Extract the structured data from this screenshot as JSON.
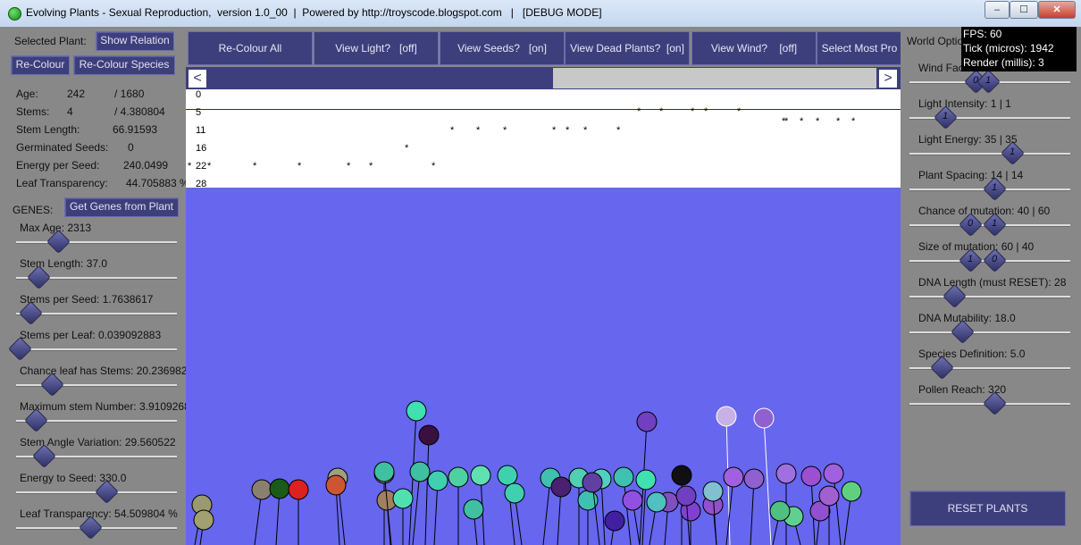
{
  "window": {
    "title": "Evolving Plants - Sexual Reproduction,  version 1.0_00  |  Powered by http://troyscode.blogspot.com   |   [DEBUG MODE]",
    "controls": {
      "minimize": "‒",
      "maximize": "☐",
      "close": "✕"
    }
  },
  "left": {
    "selected_plant_label": "Selected Plant:",
    "show_relation": "Show Relation",
    "recolour": "Re-Colour",
    "recolour_species": "Re-Colour Species",
    "stats": [
      {
        "label": "Age:",
        "value": "242",
        "extra": "/ 1680"
      },
      {
        "label": "Stems:",
        "value": "4",
        "extra": "/ 4.380804"
      },
      {
        "label": "Stem Length:",
        "value": "66.91593",
        "extra": ""
      },
      {
        "label": "Germinated Seeds:",
        "value": "0",
        "extra": ""
      },
      {
        "label": "Energy per Seed:",
        "value": "240.0499",
        "extra": ""
      },
      {
        "label": "Leaf Transparency:",
        "value": "44.705883 %",
        "extra": ""
      }
    ],
    "genes_label": "GENES:",
    "get_genes": "Get Genes from Plant",
    "genes": [
      {
        "label": "Max Age: 2313",
        "level": 0.26
      },
      {
        "label": "Stem Length: 37.0",
        "level": 0.14
      },
      {
        "label": "Stems per Seed: 1.7638617",
        "level": 0.09
      },
      {
        "label": "Stems per Leaf: 0.039092883",
        "level": 0.02
      },
      {
        "label": "Chance leaf has Stems: 20.236982",
        "level": 0.22
      },
      {
        "label": "Maximum stem Number: 3.9109268",
        "level": 0.12
      },
      {
        "label": "Stem Angle Variation: 29.560522",
        "level": 0.17
      },
      {
        "label": "Energy to Seed: 330.0",
        "level": 0.56
      },
      {
        "label": "Leaf Transparency: 54.509804 %",
        "level": 0.46
      }
    ]
  },
  "toolbar": {
    "buttons": [
      "Re-Colour All",
      "View Light?   [off]",
      "View Seeds?   [on]",
      "View Dead Plants?  [on]",
      "View Wind?    [off]",
      "Select Most Pro"
    ]
  },
  "scroll": {
    "left_arrow": "<",
    "right_arrow": ">"
  },
  "relation": {
    "rows": [
      "0",
      "5",
      "11",
      "16",
      "22",
      "28"
    ],
    "star": "*"
  },
  "right": {
    "world_options": "World Optio",
    "options": [
      {
        "label": "Wind Fac",
        "knobs": [
          {
            "text": "0",
            "level": 0.41
          },
          {
            "text": "1",
            "level": 0.49
          }
        ]
      },
      {
        "label": "Light Intensity: 1 | 1",
        "knobs": [
          {
            "text": "1",
            "level": 0.22
          }
        ]
      },
      {
        "label": "Light Energy: 35 | 35",
        "knobs": [
          {
            "text": "1",
            "level": 0.64
          }
        ]
      },
      {
        "label": "Plant Spacing: 14 | 14",
        "knobs": [
          {
            "text": "1",
            "level": 0.53
          }
        ]
      },
      {
        "label": "Chance of mutation: 40 | 60",
        "knobs": [
          {
            "text": "0",
            "level": 0.38
          },
          {
            "text": "1",
            "level": 0.53
          }
        ]
      },
      {
        "label": "Size of mutation: 60 | 40",
        "knobs": [
          {
            "text": "1",
            "level": 0.38
          },
          {
            "text": "0",
            "level": 0.53
          }
        ]
      },
      {
        "label": "DNA Length (must RESET): 28",
        "knobs": [
          {
            "text": "",
            "level": 0.28
          }
        ]
      },
      {
        "label": "DNA Mutability: 18.0",
        "knobs": [
          {
            "text": "",
            "level": 0.33
          }
        ]
      },
      {
        "label": "Species Definition: 5.0",
        "knobs": [
          {
            "text": "",
            "level": 0.2
          }
        ]
      },
      {
        "label": "Pollen Reach: 320",
        "knobs": [
          {
            "text": "",
            "level": 0.53
          }
        ]
      }
    ],
    "reset": "RESET PLANTS"
  },
  "debug": {
    "fps": "FPS: 60",
    "tick": "Tick (micros): 1942",
    "render": "Render (millis): 3"
  },
  "colors": {
    "panel": "#888888",
    "button": "#3d3f7c",
    "world": "#6666ee"
  }
}
